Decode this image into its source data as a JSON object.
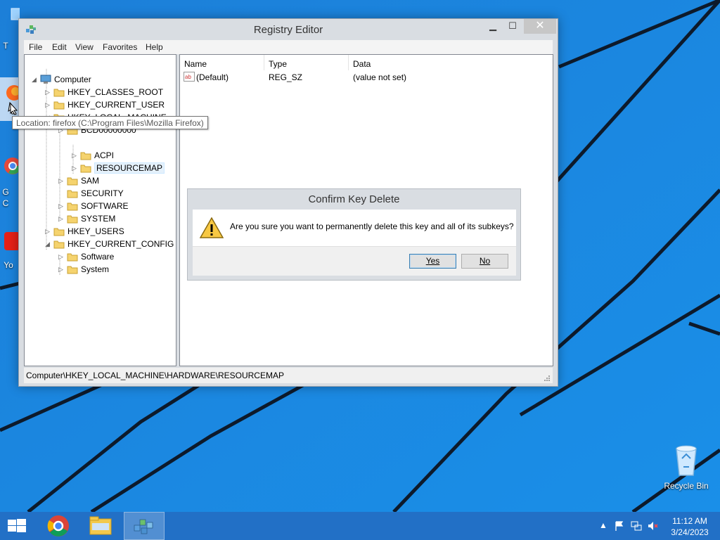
{
  "window": {
    "title": "Registry Editor",
    "controls": {
      "minimize": "▁",
      "maximize": "☐",
      "close": "✕"
    }
  },
  "menu": [
    "File",
    "Edit",
    "View",
    "Favorites",
    "Help"
  ],
  "tree": [
    {
      "label": "Computer",
      "level": 0,
      "expander": "◢"
    },
    {
      "label": "HKEY_CLASSES_ROOT",
      "level": 1,
      "expander": "▷"
    },
    {
      "label": "HKEY_CURRENT_USER",
      "level": 1,
      "expander": "▷"
    },
    {
      "label": "HKEY_LOCAL_MACHINE",
      "level": 1,
      "expander": "◢"
    },
    {
      "label": "BCD00000000",
      "level": 2,
      "expander": "▷"
    },
    {
      "label": "ACPI",
      "level": 3,
      "expander": "▷"
    },
    {
      "label": "RESOURCEMAP",
      "level": 3,
      "expander": "▷",
      "selected": true
    },
    {
      "label": "SAM",
      "level": 2,
      "expander": "▷"
    },
    {
      "label": "SECURITY",
      "level": 2,
      "expander": ""
    },
    {
      "label": "SOFTWARE",
      "level": 2,
      "expander": "▷"
    },
    {
      "label": "SYSTEM",
      "level": 2,
      "expander": "▷"
    },
    {
      "label": "HKEY_USERS",
      "level": 1,
      "expander": "▷"
    },
    {
      "label": "HKEY_CURRENT_CONFIG",
      "level": 1,
      "expander": "◢"
    },
    {
      "label": "Software",
      "level": 2,
      "expander": "▷"
    },
    {
      "label": "System",
      "level": 2,
      "expander": "▷"
    }
  ],
  "list": {
    "columns": [
      "Name",
      "Type",
      "Data"
    ],
    "rows": [
      {
        "name": "(Default)",
        "type": "REG_SZ",
        "data": "(value not set)",
        "icon": "string-value-icon"
      }
    ]
  },
  "status_path": "Computer\\HKEY_LOCAL_MACHINE\\HARDWARE\\RESOURCEMAP",
  "tooltip": "Location: firefox (C:\\Program Files\\Mozilla Firefox)",
  "dialog": {
    "title": "Confirm Key Delete",
    "message": "Are you sure you want to permanently delete this key and all of its subkeys?",
    "yes_label": "Yes",
    "no_label": "No"
  },
  "desktop": {
    "recycle_bin_label": "Recycle Bin",
    "partial_labels": [
      "T",
      "G",
      "C",
      "Yo"
    ]
  },
  "taskbar": {
    "time": "11:12 AM",
    "date": "3/24/2023",
    "pinned": [
      "start-button",
      "chrome-icon",
      "file-explorer-icon",
      "regedit-icon"
    ]
  },
  "colors": {
    "desktop": "#1f86e0",
    "taskbar": "#2270c6",
    "accent_stripe": "#0d1a2b"
  }
}
